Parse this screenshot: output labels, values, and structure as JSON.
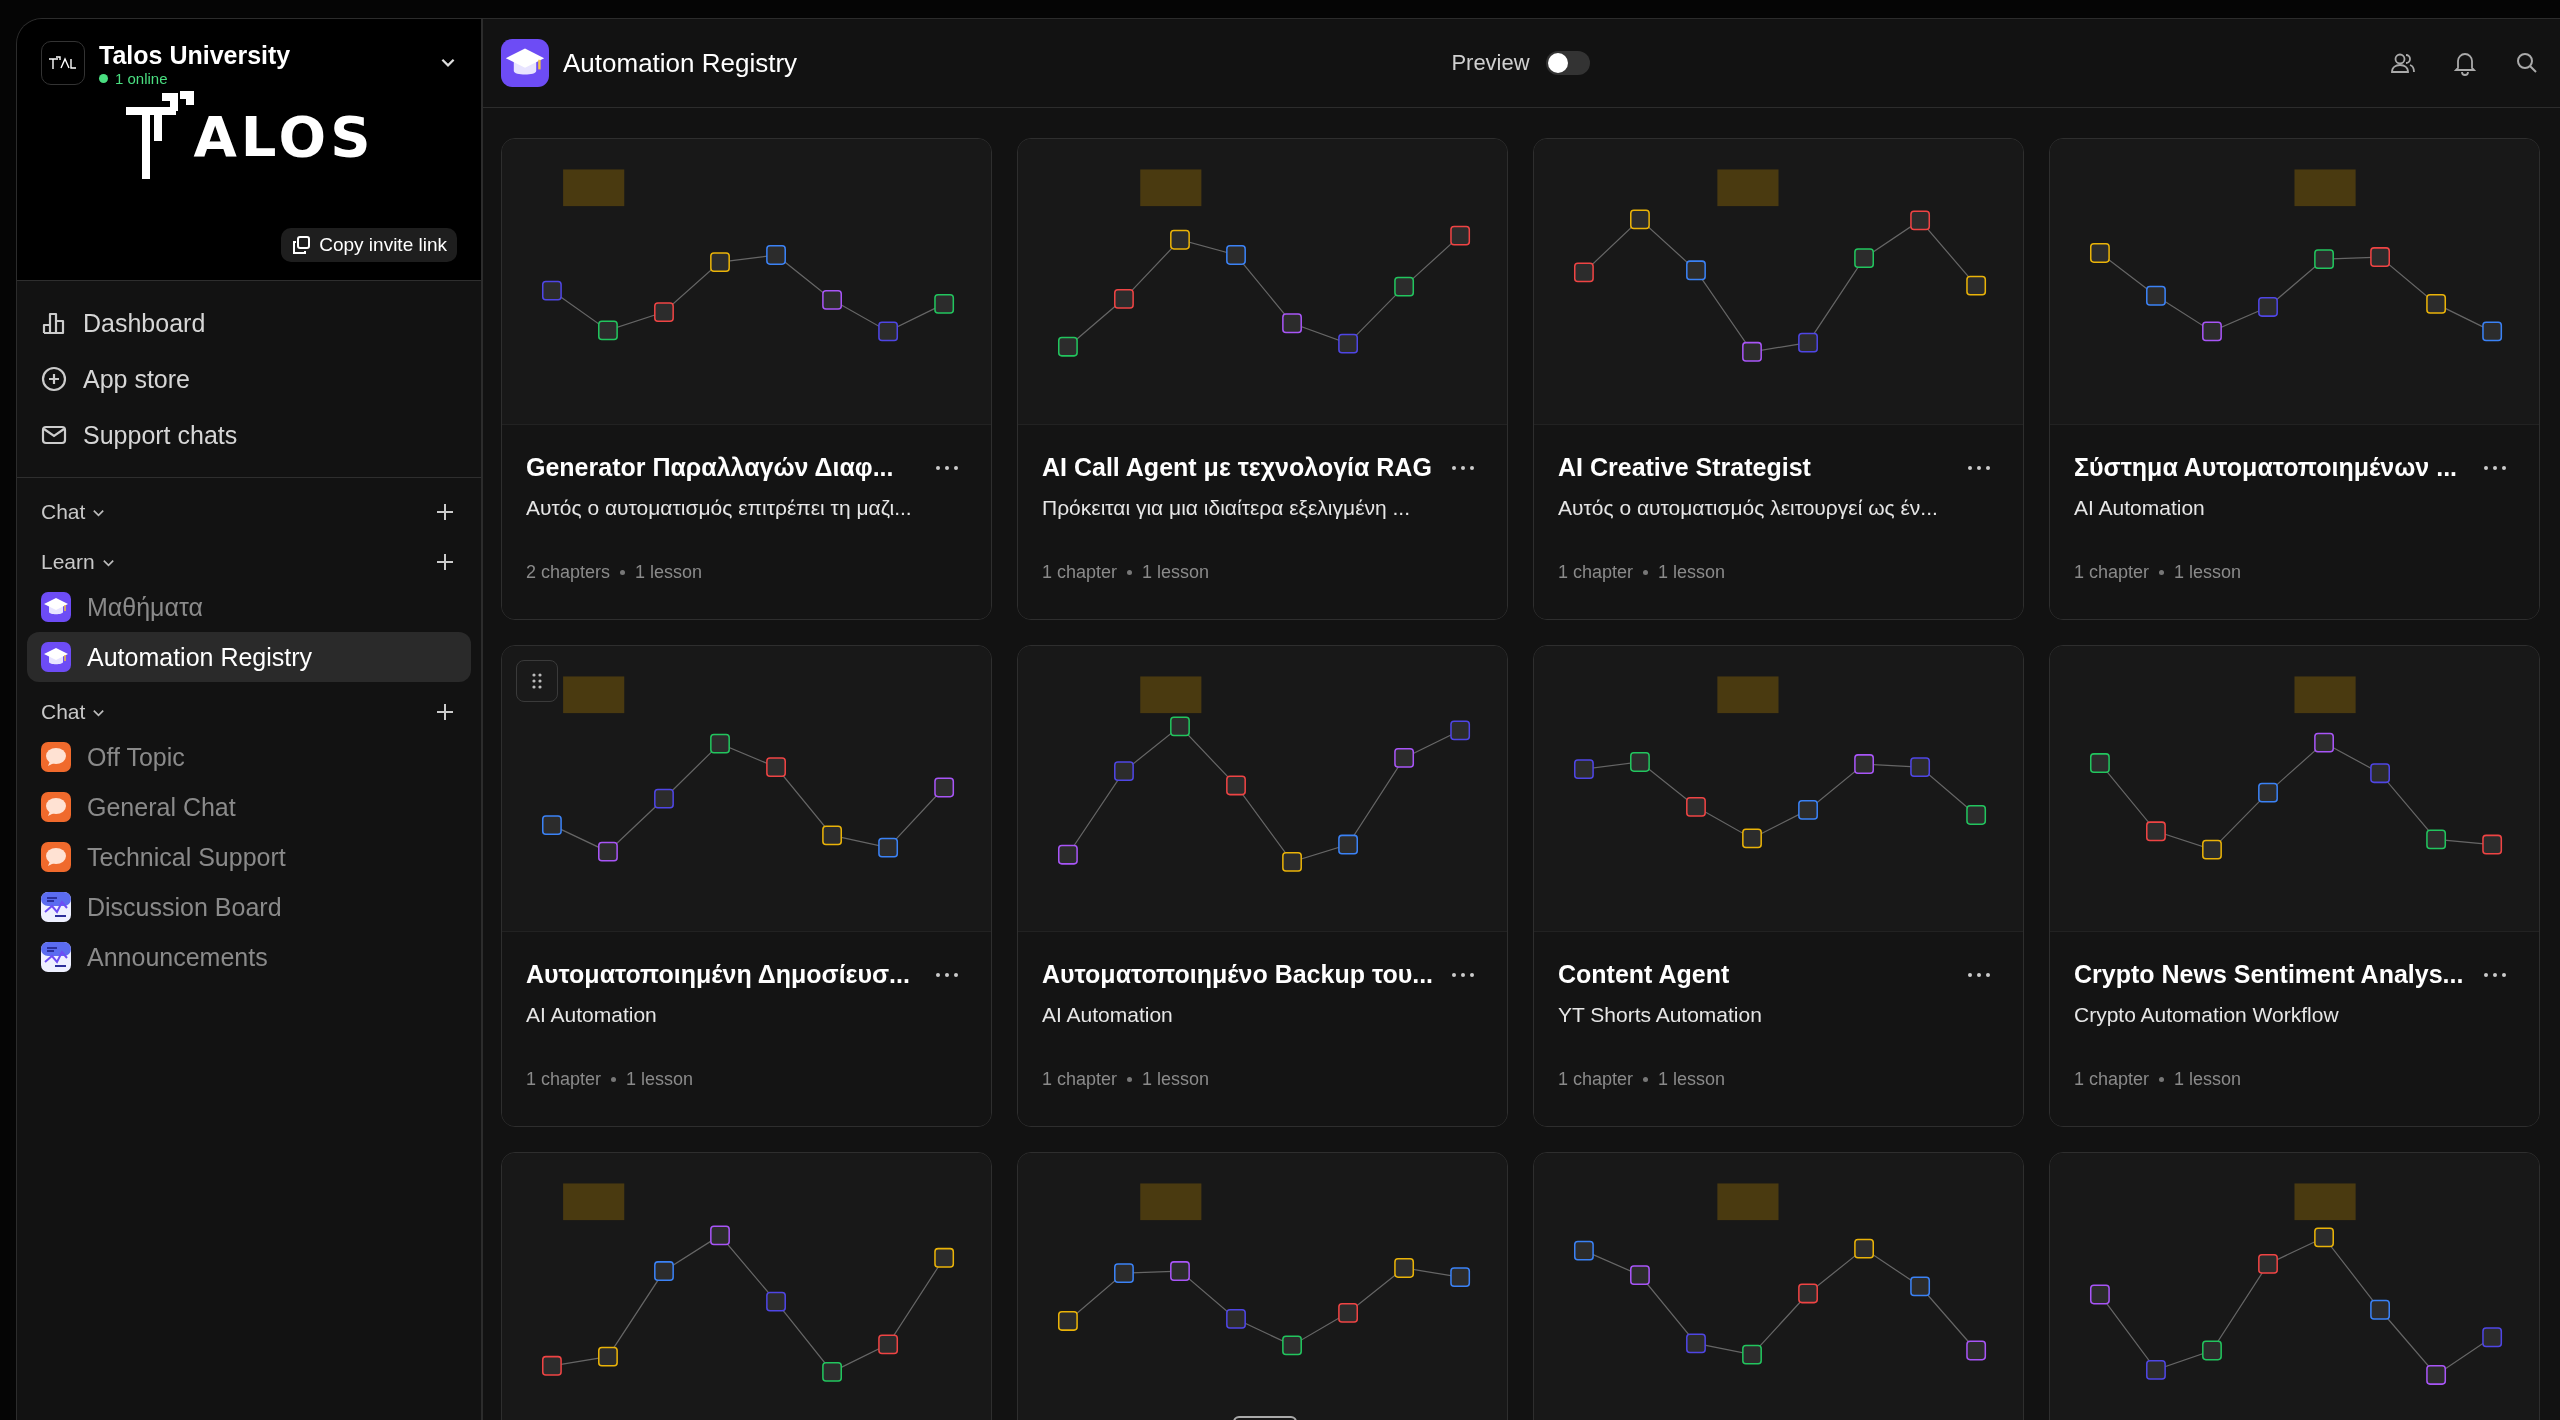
{
  "workspace": {
    "name": "Talos University",
    "online": "1 online",
    "logo_text": "ALOS",
    "invite_button": "Copy invite link"
  },
  "nav": [
    {
      "kind": "chart",
      "label": "Dashboard"
    },
    {
      "kind": "plus",
      "label": "App store"
    },
    {
      "kind": "mail",
      "label": "Support chats"
    }
  ],
  "sections": [
    {
      "title": "Chat"
    },
    {
      "title": "Learn",
      "items": [
        {
          "kind": "course",
          "label": "Μαθήματα",
          "selected": false
        },
        {
          "kind": "course",
          "label": "Automation Registry",
          "selected": true
        }
      ]
    },
    {
      "title": "Chat",
      "items": [
        {
          "kind": "chat",
          "label": "Off Topic",
          "selected": false
        },
        {
          "kind": "chat",
          "label": "General Chat",
          "selected": false
        },
        {
          "kind": "chat",
          "label": "Technical Support",
          "selected": false
        },
        {
          "kind": "board",
          "label": "Discussion Board",
          "selected": false
        },
        {
          "kind": "board",
          "label": "Announcements",
          "selected": false
        }
      ]
    }
  ],
  "header": {
    "title": "Automation Registry",
    "preview_label": "Preview",
    "preview_on": false
  },
  "cards": [
    {
      "kind": "lesson",
      "title": "Generator Παραλλαγών Διαφ...",
      "subtitle": "Αυτός ο αυτοματισμός επιτρέπει τη μαζι...",
      "chapters": "2 chapters",
      "lessons": "1 lesson"
    },
    {
      "kind": "lesson",
      "title": "AI Call Agent με τεχνολογία RAG",
      "subtitle": "Πρόκειται για μια ιδιαίτερα εξελιγμένη ...",
      "chapters": "1 chapter",
      "lessons": "1 lesson"
    },
    {
      "kind": "lesson",
      "title": "AI Creative Strategist",
      "subtitle": "Αυτός ο αυτοματισμός λειτουργεί ως έν...",
      "chapters": "1 chapter",
      "lessons": "1 lesson"
    },
    {
      "kind": "lesson",
      "title": "Σύστημα Αυτοματοποιημένων ...",
      "subtitle": "AI Automation",
      "chapters": "1 chapter",
      "lessons": "1 lesson"
    },
    {
      "kind": "lesson",
      "title": "Αυτοματοποιημένη Δημοσίευσ...",
      "subtitle": "AI Automation",
      "chapters": "1 chapter",
      "lessons": "1 lesson",
      "drag_handle": true
    },
    {
      "kind": "lesson",
      "title": "Αυτοματοποιημένο Backup του...",
      "subtitle": "AI Automation",
      "chapters": "1 chapter",
      "lessons": "1 lesson"
    },
    {
      "kind": "lesson",
      "title": "Content Agent",
      "subtitle": "YT Shorts Automation",
      "chapters": "1 chapter",
      "lessons": "1 lesson"
    },
    {
      "kind": "lesson",
      "title": "Crypto News Sentiment Analys...",
      "subtitle": "Crypto Automation Workflow",
      "chapters": "1 chapter",
      "lessons": "1 lesson"
    },
    {
      "kind": "picture"
    },
    {
      "kind": "picture"
    },
    {
      "kind": "picture"
    },
    {
      "kind": "picture"
    }
  ]
}
